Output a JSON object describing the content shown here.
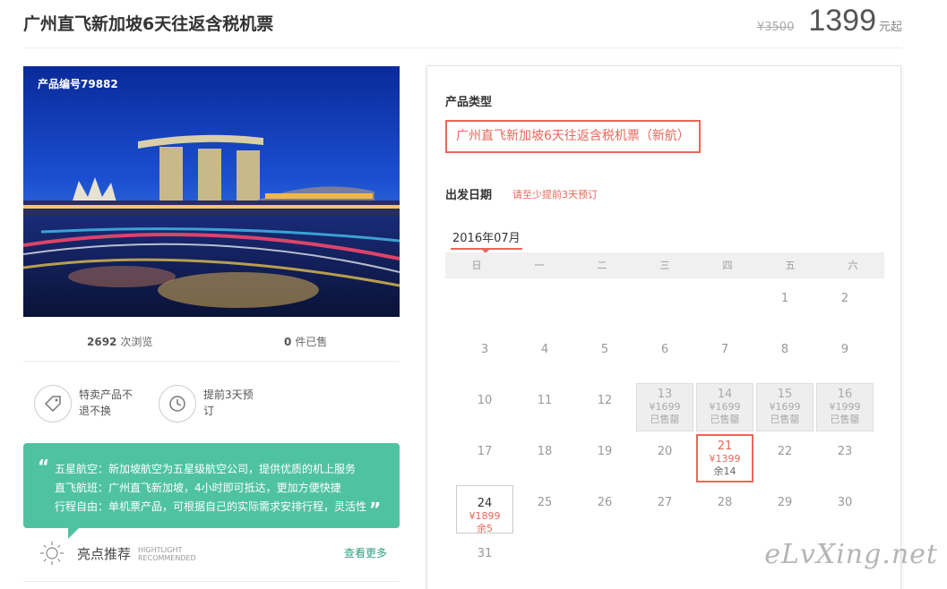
{
  "header": {
    "title": "广州直飞新加坡6天往返含税机票",
    "original_price": "¥3500",
    "price": "1399",
    "price_unit": "元起"
  },
  "hero": {
    "product_code": "产品编号79882"
  },
  "stats": {
    "views_count": "2692",
    "views_label": "次浏览",
    "sold_count": "0",
    "sold_label": "件已售"
  },
  "features": [
    {
      "icon": "tag-icon",
      "text": "特卖产品不退不换"
    },
    {
      "icon": "clock-icon",
      "text": "提前3天预订"
    }
  ],
  "bubble": {
    "open_quote": "“",
    "close_quote": "”",
    "lines": [
      "五星航空：新加坡航空为五星级航空公司，提供优质的机上服务",
      "直飞航班：广州直飞新加坡，4小时即可抵达，更加方便快捷",
      "行程自由：单机票产品，可根据自己的实际需求安排行程，灵活性"
    ]
  },
  "highlights": {
    "title": "亮点推荐",
    "sub_1": "HIGHTLIGHT",
    "sub_2": "RECOMMENDED",
    "more": "查看更多"
  },
  "panel": {
    "type_label": "产品类型",
    "type_option": "广州直飞新加坡6天往返含税机票（新航）",
    "date_label": "出发日期",
    "date_hint": "请至少提前3天预订",
    "month": "2016年07月",
    "weekdays": [
      "日",
      "一",
      "二",
      "三",
      "四",
      "五",
      "六"
    ],
    "days": [
      {
        "day": "1"
      },
      {
        "day": "2"
      },
      {
        "day": "3"
      },
      {
        "day": "4"
      },
      {
        "day": "5"
      },
      {
        "day": "6"
      },
      {
        "day": "7"
      },
      {
        "day": "8"
      },
      {
        "day": "9"
      },
      {
        "day": "10"
      },
      {
        "day": "11"
      },
      {
        "day": "12"
      },
      {
        "day": "13",
        "status": "sold",
        "price": "¥1699",
        "note": "已售罄"
      },
      {
        "day": "14",
        "status": "sold",
        "price": "¥1699",
        "note": "已售罄"
      },
      {
        "day": "15",
        "status": "sold",
        "price": "¥1699",
        "note": "已售罄"
      },
      {
        "day": "16",
        "status": "sold",
        "price": "¥1999",
        "note": "已售罄"
      },
      {
        "day": "17"
      },
      {
        "day": "18"
      },
      {
        "day": "19"
      },
      {
        "day": "20"
      },
      {
        "day": "21",
        "status": "selected",
        "price": "¥1399",
        "note": "余14"
      },
      {
        "day": "22"
      },
      {
        "day": "23"
      },
      {
        "day": "24",
        "status": "available",
        "price": "¥1899",
        "note": "余5"
      },
      {
        "day": "25"
      },
      {
        "day": "26"
      },
      {
        "day": "27"
      },
      {
        "day": "28"
      },
      {
        "day": "29"
      },
      {
        "day": "30"
      },
      {
        "day": "31"
      }
    ]
  },
  "watermark": "eLvXing.net",
  "colors": {
    "accent": "#e8675a",
    "bubble": "#4fc3a1",
    "more_link": "#2e9d7f"
  }
}
